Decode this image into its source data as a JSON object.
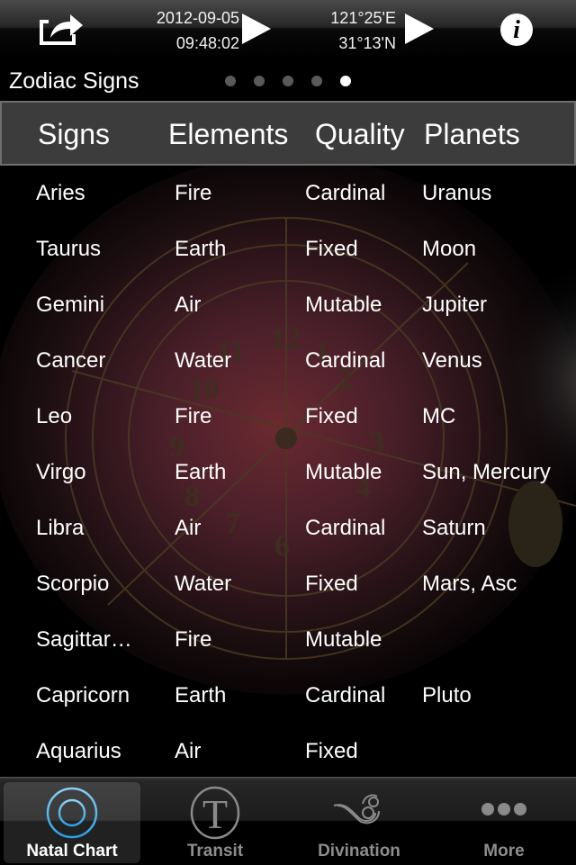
{
  "toolbar": {
    "share_icon": "share-icon",
    "date": "2012-09-05",
    "time": "09:48:02",
    "longitude": "121°25'E",
    "latitude": "31°13'N",
    "info_icon": "i"
  },
  "header": {
    "title": "Zodiac Signs",
    "page_indicator": {
      "total": 5,
      "current": 5
    }
  },
  "table": {
    "columns": [
      "Signs",
      "Elements",
      "Quality",
      "Planets"
    ],
    "rows": [
      [
        "Aries",
        "Fire",
        "Cardinal",
        "Uranus"
      ],
      [
        "Taurus",
        "Earth",
        "Fixed",
        "Moon"
      ],
      [
        "Gemini",
        "Air",
        "Mutable",
        "Jupiter"
      ],
      [
        "Cancer",
        "Water",
        "Cardinal",
        "Venus"
      ],
      [
        "Leo",
        "Fire",
        "Fixed",
        "MC"
      ],
      [
        "Virgo",
        "Earth",
        "Mutable",
        "Sun, Mercury"
      ],
      [
        "Libra",
        "Air",
        "Cardinal",
        "Saturn"
      ],
      [
        "Scorpio",
        "Water",
        "Fixed",
        "Mars, Asc"
      ],
      [
        "Sagittar…",
        "Fire",
        "Mutable",
        ""
      ],
      [
        "Capricorn",
        "Earth",
        "Cardinal",
        "Pluto"
      ],
      [
        "Aquarius",
        "Air",
        "Fixed",
        ""
      ]
    ]
  },
  "tabbar": {
    "tabs": [
      {
        "label": "Natal Chart",
        "icon": "crosshair-circle-icon",
        "active": true
      },
      {
        "label": "Transit",
        "icon": "letter-t-circle-icon",
        "active": false
      },
      {
        "label": "Divination",
        "icon": "swirl-cloud-icon",
        "active": false
      },
      {
        "label": "More",
        "icon": "more-dots-icon",
        "active": false
      }
    ]
  },
  "colors": {
    "accent_blue": "#4fb8f0",
    "inactive_tab": "#8d8d8d",
    "header_bg": "#3c3c3c"
  }
}
